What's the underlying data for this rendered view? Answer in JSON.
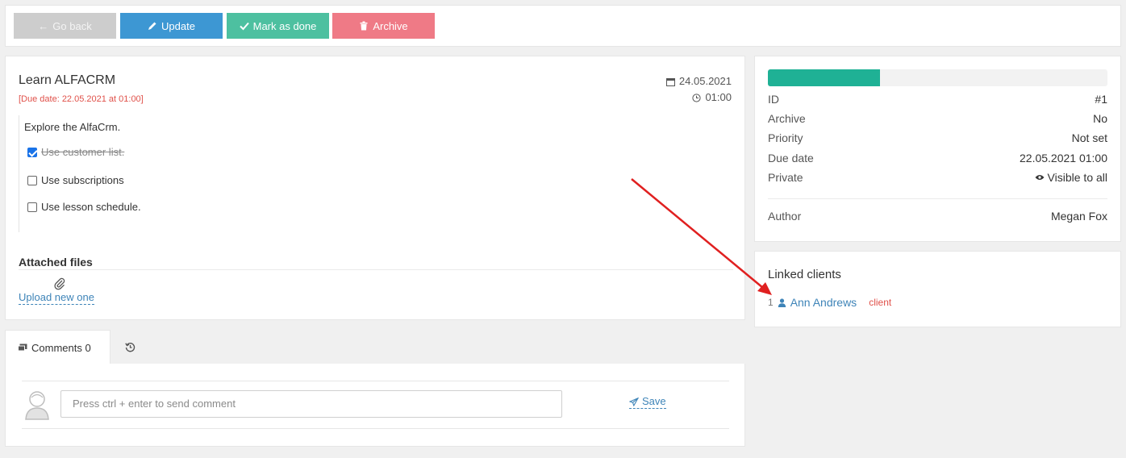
{
  "toolbar": {
    "back_label": "Go back",
    "update_label": "Update",
    "done_label": "Mark as done",
    "archive_label": "Archive"
  },
  "task": {
    "title": "Learn ALFACRM",
    "due_note": "[Due date: 22.05.2021 at 01:00]",
    "date": "24.05.2021",
    "time": "01:00",
    "description": "Explore the AlfaCrm.",
    "checklist": [
      {
        "label": "Use customer list.",
        "checked": true
      },
      {
        "label": "Use subscriptions",
        "checked": false
      },
      {
        "label": "Use lesson schedule.",
        "checked": false
      }
    ],
    "files_heading": "Attached files",
    "upload_label": "Upload new one"
  },
  "comments": {
    "tab_label": "Comments 0",
    "placeholder": "Press ctrl + enter to send comment",
    "save_label": "Save"
  },
  "info": {
    "progress": 0.33,
    "progress_color": "#1fb195",
    "rows": [
      {
        "label": "ID",
        "value": "#1"
      },
      {
        "label": "Archive",
        "value": "No"
      },
      {
        "label": "Priority",
        "value": "Not set"
      },
      {
        "label": "Due date",
        "value": "22.05.2021 01:00"
      },
      {
        "label": "Private",
        "value": "Visible to all",
        "icon": "eye-icon"
      }
    ],
    "author_label": "Author",
    "author_value": "Megan Fox"
  },
  "linked": {
    "heading": "Linked clients",
    "clients": [
      {
        "num": "1",
        "name": "Ann Andrews",
        "role": "client"
      }
    ]
  },
  "colors": {
    "update": "#3d97d3",
    "done": "#4dc0a0",
    "archive": "#ef7a86",
    "back": "#cdcdcd",
    "link": "#3e84b8",
    "danger": "#e0514a",
    "annotation_arrow": "#e02020"
  }
}
